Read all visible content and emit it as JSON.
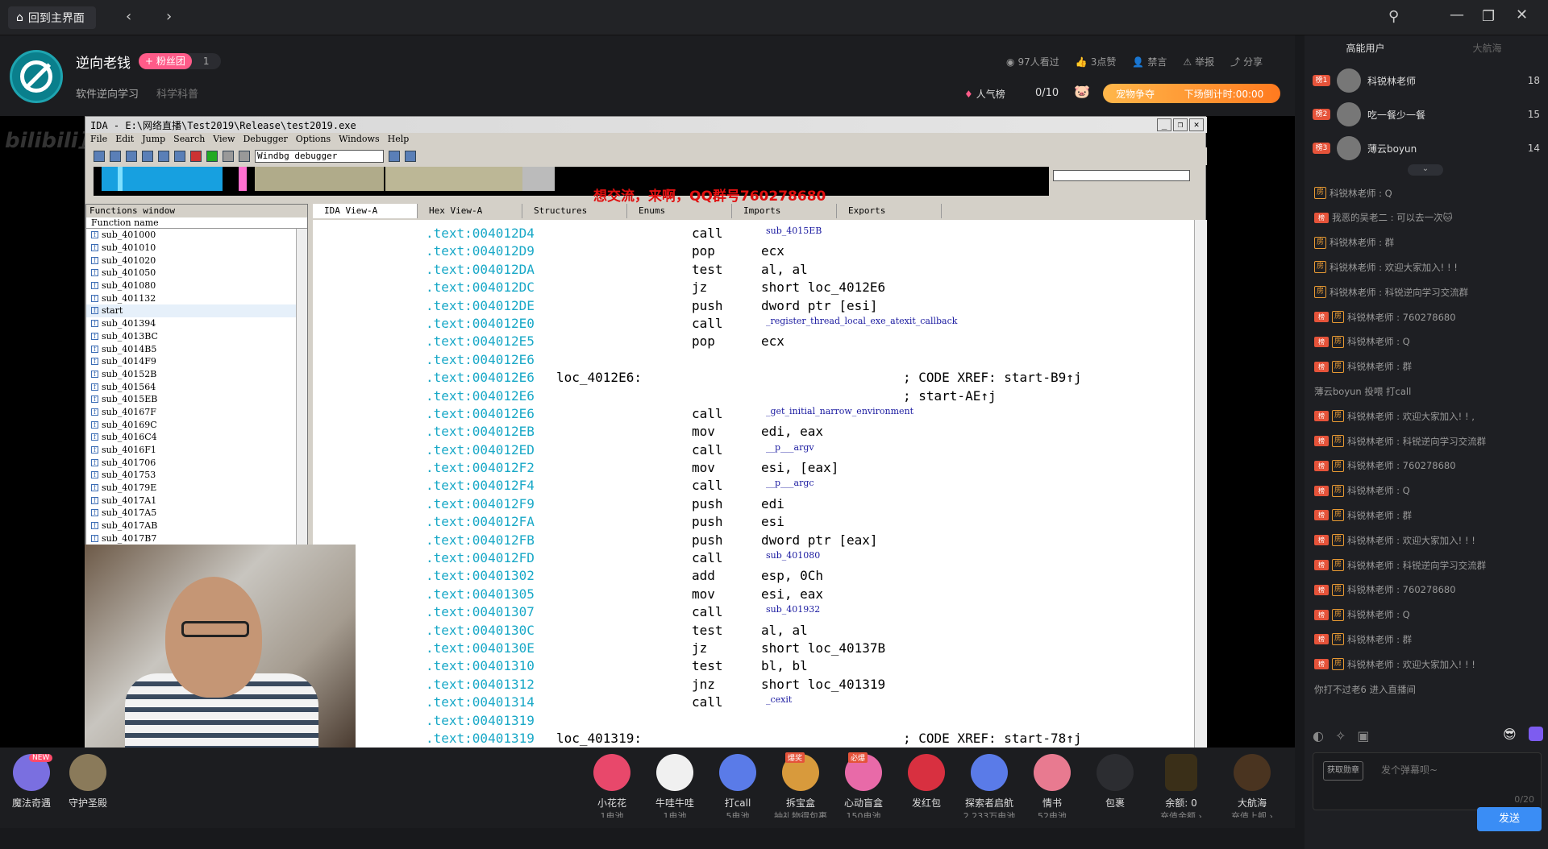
{
  "topbar": {
    "home_label": "回到主界面"
  },
  "header": {
    "streamer": "逆向老钱",
    "fan_badge": "+ 粉丝团",
    "fan_level": "1",
    "category": "软件逆向学习",
    "subcategory": "科学科普",
    "views": "97人看过",
    "likes": "3点赞",
    "block": "禁言",
    "report": "举报",
    "share": "分享",
    "popularity": "人气榜",
    "progress": "0/10",
    "event_left": "宠物争夺",
    "event_right": "下场倒计时:00:00"
  },
  "ida": {
    "title": "IDA - E:\\网络直播\\Test2019\\Release\\test2019.exe",
    "menu": [
      "File",
      "Edit",
      "Jump",
      "Search",
      "View",
      "Debugger",
      "Options",
      "Windows",
      "Help"
    ],
    "debugger": "Windbg debugger",
    "qq_text": "想交流，来啊，QQ群号760278680",
    "functions_title": "Functions window",
    "function_col": "Function name",
    "functions": [
      "sub_401000",
      "sub_401010",
      "sub_401020",
      "sub_401050",
      "sub_401080",
      "sub_401132",
      "start",
      "sub_401394",
      "sub_4013BC",
      "sub_4014B5",
      "sub_4014F9",
      "sub_40152B",
      "sub_401564",
      "sub_4015EB",
      "sub_40167F",
      "sub_40169C",
      "sub_4016C4",
      "sub_4016F1",
      "sub_401706",
      "sub_401753",
      "sub_40179E",
      "sub_4017A1",
      "sub_4017A5",
      "sub_4017AB",
      "sub_4017B7"
    ],
    "tabs": [
      "IDA View-A",
      "Hex View-A",
      "Structures",
      "Enums",
      "Imports",
      "Exports"
    ],
    "lines": [
      {
        "a": ".text:004012D4",
        "l": "",
        "m": "call",
        "o": "sub_4015EB",
        "c": ""
      },
      {
        "a": ".text:004012D9",
        "l": "",
        "m": "pop",
        "o": "ecx",
        "c": ""
      },
      {
        "a": ".text:004012DA",
        "l": "",
        "m": "test",
        "o": "al, al",
        "c": ""
      },
      {
        "a": ".text:004012DC",
        "l": "",
        "m": "jz",
        "o": "short loc_4012E6",
        "c": ""
      },
      {
        "a": ".text:004012DE",
        "l": "",
        "m": "push",
        "o": "dword ptr [esi]",
        "c": ""
      },
      {
        "a": ".text:004012E0",
        "l": "",
        "m": "call",
        "o": "_register_thread_local_exe_atexit_callback",
        "c": ""
      },
      {
        "a": ".text:004012E5",
        "l": "",
        "m": "pop",
        "o": "ecx",
        "c": ""
      },
      {
        "a": ".text:004012E6",
        "l": "",
        "m": "",
        "o": "",
        "c": ""
      },
      {
        "a": ".text:004012E6",
        "l": "loc_4012E6:",
        "m": "",
        "o": "",
        "c": "; CODE XREF: start-B9↑j"
      },
      {
        "a": ".text:004012E6",
        "l": "",
        "m": "",
        "o": "",
        "c": "; start-AE↑j"
      },
      {
        "a": ".text:004012E6",
        "l": "",
        "m": "call",
        "o": "_get_initial_narrow_environment",
        "c": ""
      },
      {
        "a": ".text:004012EB",
        "l": "",
        "m": "mov",
        "o": "edi, eax",
        "c": ""
      },
      {
        "a": ".text:004012ED",
        "l": "",
        "m": "call",
        "o": "__p___argv",
        "c": ""
      },
      {
        "a": ".text:004012F2",
        "l": "",
        "m": "mov",
        "o": "esi, [eax]",
        "c": ""
      },
      {
        "a": ".text:004012F4",
        "l": "",
        "m": "call",
        "o": "__p___argc",
        "c": ""
      },
      {
        "a": ".text:004012F9",
        "l": "",
        "m": "push",
        "o": "edi",
        "c": ""
      },
      {
        "a": ".text:004012FA",
        "l": "",
        "m": "push",
        "o": "esi",
        "c": ""
      },
      {
        "a": ".text:004012FB",
        "l": "",
        "m": "push",
        "o": "dword ptr [eax]",
        "c": ""
      },
      {
        "a": ".text:004012FD",
        "l": "",
        "m": "call",
        "o": "sub_401080",
        "c": ""
      },
      {
        "a": ".text:00401302",
        "l": "",
        "m": "add",
        "o": "esp, 0Ch",
        "c": ""
      },
      {
        "a": ".text:00401305",
        "l": "",
        "m": "mov",
        "o": "esi, eax",
        "c": ""
      },
      {
        "a": ".text:00401307",
        "l": "",
        "m": "call",
        "o": "sub_401932",
        "c": ""
      },
      {
        "a": ".text:0040130C",
        "l": "",
        "m": "test",
        "o": "al, al",
        "c": ""
      },
      {
        "a": ".text:0040130E",
        "l": "",
        "m": "jz",
        "o": "short loc_40137B",
        "c": ""
      },
      {
        "a": ".text:00401310",
        "l": "",
        "m": "test",
        "o": "bl, bl",
        "c": ""
      },
      {
        "a": ".text:00401312",
        "l": "",
        "m": "jnz",
        "o": "short loc_401319",
        "c": ""
      },
      {
        "a": ".text:00401314",
        "l": "",
        "m": "call",
        "o": "_cexit",
        "c": ""
      },
      {
        "a": ".text:00401319",
        "l": "",
        "m": "",
        "o": "",
        "c": ""
      },
      {
        "a": ".text:00401319",
        "l": "loc_401319:",
        "m": "",
        "o": "",
        "c": "; CODE XREF: start-78↑j"
      }
    ]
  },
  "gifts": {
    "left": [
      {
        "name": "魔法奇遇",
        "badge": "NEW"
      },
      {
        "name": "守护圣殿"
      }
    ],
    "items": [
      {
        "name": "小花花",
        "price": "1电池"
      },
      {
        "name": "牛哇牛哇",
        "price": "1电池"
      },
      {
        "name": "打call",
        "price": "5电池"
      },
      {
        "name": "拆宝盒",
        "price": "抽礼物得包裹",
        "tag": "爆奖"
      },
      {
        "name": "心动盲盒",
        "price": "150电池",
        "tag": "必爆"
      },
      {
        "name": "发红包",
        "price": ""
      },
      {
        "name": "探索者启航",
        "price": "2,233万电池"
      },
      {
        "name": "情书",
        "price": "52电池"
      },
      {
        "name": "包裹",
        "price": ""
      }
    ],
    "balance": "余额: 0",
    "balance_sub": "充值余额 ›",
    "ship": "大航海",
    "ship_sub": "充值上舰 ›"
  },
  "right": {
    "tabs": [
      "高能用户",
      "大航海"
    ],
    "ranks": [
      {
        "badge": "榜1",
        "name": "科锐林老师",
        "value": "18"
      },
      {
        "badge": "榜2",
        "name": "吃一餐少一餐",
        "value": "15"
      },
      {
        "badge": "榜3",
        "name": "薄云boyun",
        "value": "14"
      }
    ],
    "messages": [
      {
        "badges": "房",
        "text": "科锐林老师 : Q"
      },
      {
        "badges": "榜3 14",
        "text": "我恶的吴老二 : 可以去一次🐱"
      },
      {
        "badges": "房",
        "text": "科锐林老师 : 群"
      },
      {
        "badges": "房",
        "text": "科锐林老师 : 欢迎大家加入! ! !"
      },
      {
        "badges": "房",
        "text": "科锐林老师 : 科锐逆向学习交流群"
      },
      {
        "badges": "榜1 房",
        "text": "科锐林老师 : 760278680"
      },
      {
        "badges": "榜1 房",
        "text": "科锐林老师 : Q"
      },
      {
        "badges": "榜1 房",
        "text": "科锐林老师 : 群"
      },
      {
        "badges": "",
        "text": "薄云boyun 投喂 打call"
      },
      {
        "badges": "榜1 房",
        "text": "科锐林老师 : 欢迎大家加入! ! ,"
      },
      {
        "badges": "榜1 房",
        "text": "科锐林老师 : 科锐逆向学习交流群"
      },
      {
        "badges": "榜1 房",
        "text": "科锐林老师 : 760278680"
      },
      {
        "badges": "榜1 房",
        "text": "科锐林老师 : Q"
      },
      {
        "badges": "榜1 房",
        "text": "科锐林老师 : 群"
      },
      {
        "badges": "榜1 房",
        "text": "科锐林老师 : 欢迎大家加入! ! !"
      },
      {
        "badges": "榜1 房",
        "text": "科锐林老师 : 科锐逆向学习交流群"
      },
      {
        "badges": "榜1 房",
        "text": "科锐林老师 : 760278680"
      },
      {
        "badges": "榜1 房",
        "text": "科锐林老师 : Q"
      },
      {
        "badges": "榜1 房",
        "text": "科锐林老师 : 群"
      },
      {
        "badges": "榜1 房",
        "text": "科锐林老师 : 欢迎大家加入! ! !"
      },
      {
        "badges": "",
        "text": "你打不过老6 进入直播间"
      }
    ],
    "placeholder": "发个弹幕呗~",
    "counter": "0/20",
    "send": "发送",
    "collect": "获取勋章"
  },
  "colors": {
    "accent": "#ff5b89",
    "address": "#18a8c7",
    "send": "#3a8df5"
  }
}
